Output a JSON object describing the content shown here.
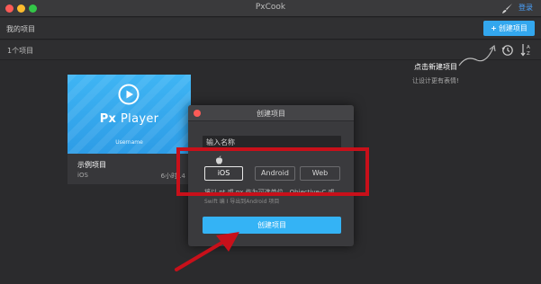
{
  "window": {
    "title": "PxCook",
    "login": "登录"
  },
  "toolbar": {
    "my_projects": "我的项目",
    "new_project": "创建项目",
    "new_project_plus": "+"
  },
  "list": {
    "count": "1个项目"
  },
  "hint": {
    "title": "点击新建项目",
    "subtitle": "让设计更有表情!"
  },
  "card": {
    "thumb_title_bold": "Px",
    "thumb_title_light": "Player",
    "thumb_user": "Username",
    "name": "示例项目",
    "platform": "iOS",
    "time": "6小时14"
  },
  "dialog": {
    "title": "创建项目",
    "name_placeholder": "输入名称",
    "platforms": [
      "iOS",
      "Android",
      "Web"
    ],
    "selected_platform": "iOS",
    "unit_note": "将以 pt 或 px 作为可选单位。Objective-C 或",
    "unit_note_2": "Swift 编 I 导出到Android 项目",
    "create": "创建项目"
  },
  "colors": {
    "accent": "#33a7ee",
    "annotation": "#c8101a",
    "background": "#2b2b2d"
  }
}
